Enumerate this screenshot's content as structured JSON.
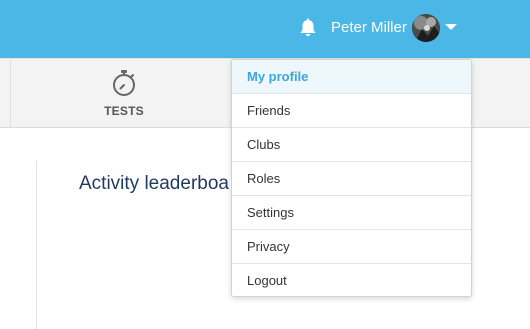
{
  "header": {
    "username": "Peter Miller",
    "bell_icon": "bell-icon",
    "avatar": "user-avatar-photo",
    "caret_icon": "caret-down-icon",
    "bar_color": "#4ab7e6"
  },
  "subnav": {
    "tabs": [
      {
        "label": "TESTS",
        "icon": "stopwatch-icon"
      }
    ]
  },
  "main": {
    "heading": "Activity leaderboa"
  },
  "dropdown": {
    "active_color": "#3aa8dc",
    "items": [
      {
        "label": "My profile",
        "active": true
      },
      {
        "label": "Friends"
      },
      {
        "label": "Clubs"
      },
      {
        "label": "Roles"
      },
      {
        "label": "Settings"
      },
      {
        "label": "Privacy"
      },
      {
        "label": "Logout"
      }
    ]
  }
}
